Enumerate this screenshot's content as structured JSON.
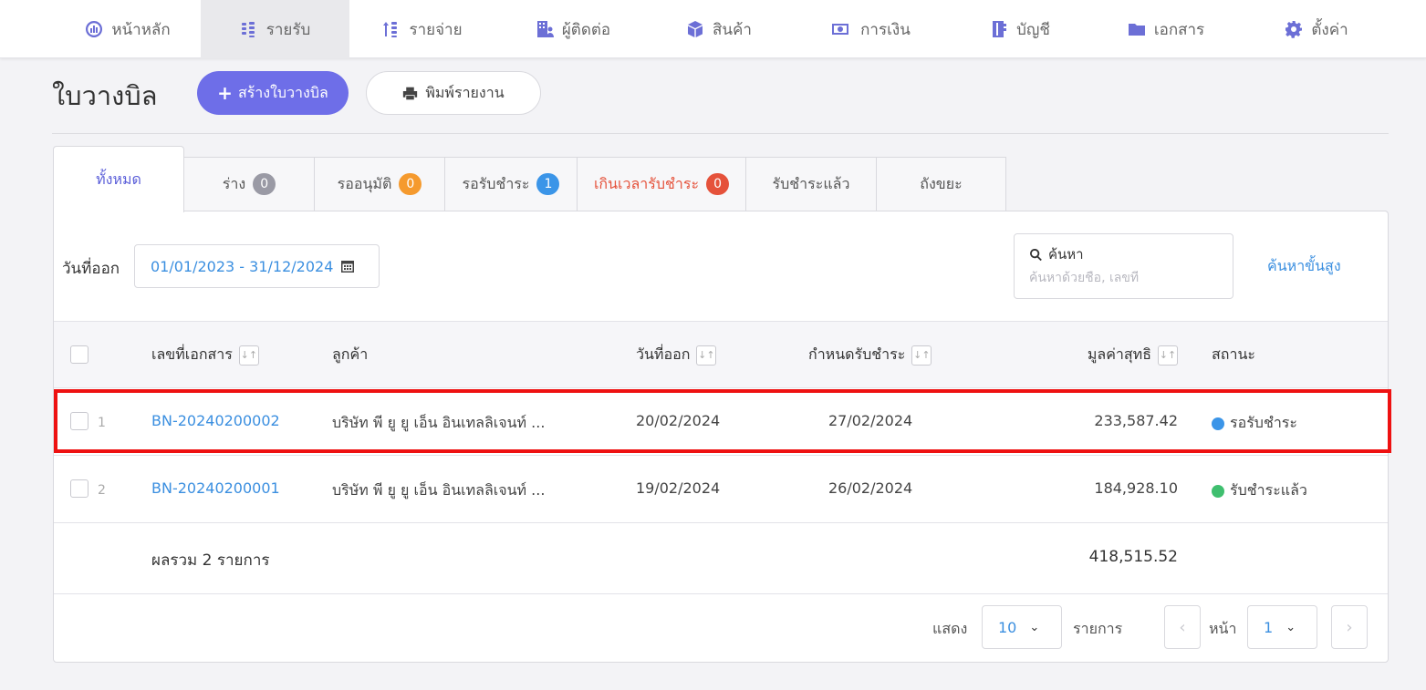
{
  "nav": {
    "items": [
      {
        "label": "หน้าหลัก",
        "icon": "dashboard-icon"
      },
      {
        "label": "รายรับ",
        "icon": "income-icon"
      },
      {
        "label": "รายจ่าย",
        "icon": "expense-icon"
      },
      {
        "label": "ผู้ติดต่อ",
        "icon": "contacts-icon"
      },
      {
        "label": "สินค้า",
        "icon": "box-icon"
      },
      {
        "label": "การเงิน",
        "icon": "money-icon"
      },
      {
        "label": "บัญชี",
        "icon": "book-icon"
      },
      {
        "label": "เอกสาร",
        "icon": "folder-icon"
      },
      {
        "label": "ตั้งค่า",
        "icon": "gear-icon"
      }
    ],
    "active_index": 1
  },
  "header": {
    "title": "ใบวางบิล",
    "create_button": "สร้างใบวางบิล",
    "print_button": "พิมพ์รายงาน"
  },
  "tabs": [
    {
      "label": "ทั้งหมด"
    },
    {
      "label": "ร่าง",
      "count": "0",
      "badge_color": "#9a9aa5"
    },
    {
      "label": "รออนุมัติ",
      "count": "0",
      "badge_color": "#f59a2e"
    },
    {
      "label": "รอรับชำระ",
      "count": "1",
      "badge_color": "#3b95e8"
    },
    {
      "label": "เกินเวลารับชำระ",
      "count": "0",
      "badge_color": "#e5523b"
    },
    {
      "label": "รับชำระแล้ว"
    },
    {
      "label": "ถังขยะ"
    }
  ],
  "filters": {
    "date_label": "วันที่ออก",
    "date_range": "01/01/2023 - 31/12/2024",
    "search_label": "ค้นหา",
    "search_placeholder": "ค้นหาด้วยชื่อ, เลขที่",
    "advanced_search": "ค้นหาขั้นสูง"
  },
  "table": {
    "columns": {
      "doc_no": "เลขที่เอกสาร",
      "customer": "ลูกค้า",
      "issue_date": "วันที่ออก",
      "due_date": "กำหนดรับชำระ",
      "net_value": "มูลค่าสุทธิ",
      "status": "สถานะ"
    },
    "rows": [
      {
        "num": "1",
        "doc_no": "BN-20240200002",
        "customer": "บริษัท พี ยู ยู เอ็น อินเทลลิเจนท์ ...",
        "issue_date": "20/02/2024",
        "due_date": "27/02/2024",
        "net_value": "233,587.42",
        "status": "รอรับชำระ",
        "status_color": "#3b95e8"
      },
      {
        "num": "2",
        "doc_no": "BN-20240200001",
        "customer": "บริษัท พี ยู ยู เอ็น อินเทลลิเจนท์ ...",
        "issue_date": "19/02/2024",
        "due_date": "26/02/2024",
        "net_value": "184,928.10",
        "status": "รับชำระแล้ว",
        "status_color": "#3fbf6f"
      }
    ],
    "total_label": "ผลรวม 2 รายการ",
    "total_value": "418,515.52"
  },
  "pagination": {
    "show_label": "แสดง",
    "page_size": "10",
    "items_label": "รายการ",
    "page_label": "หน้า",
    "page": "1"
  },
  "colors": {
    "accent": "#6e6ee8",
    "link": "#3b8fe0",
    "highlight": "#ee1111"
  }
}
